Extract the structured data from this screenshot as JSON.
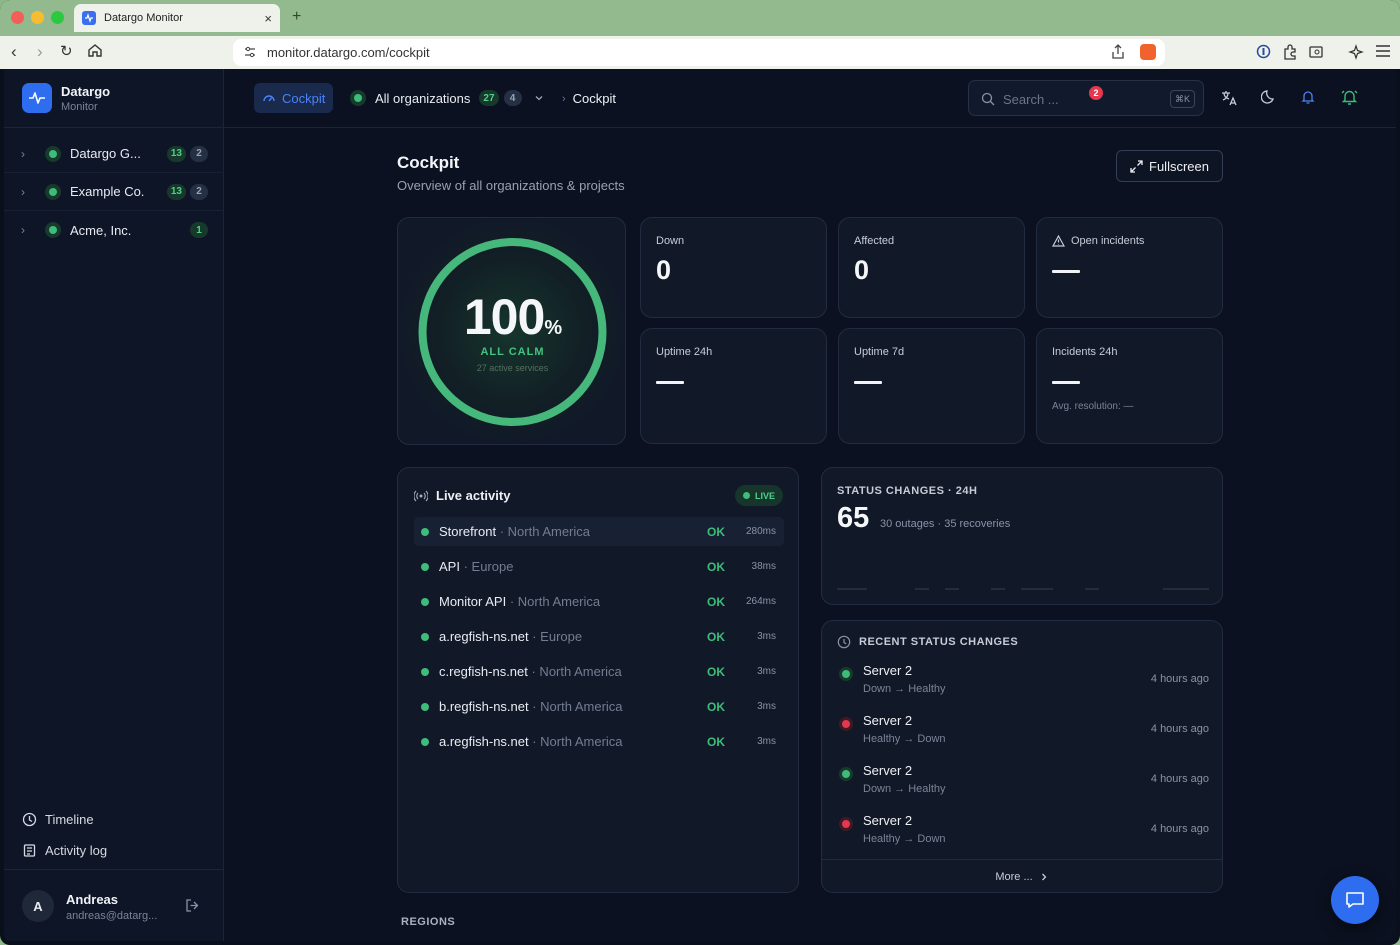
{
  "browser": {
    "tab_title": "Datargo Monitor",
    "url": "monitor.datargo.com/cockpit"
  },
  "brand": {
    "name": "Datargo",
    "sub": "Monitor"
  },
  "sidebar": {
    "orgs": [
      {
        "name": "Datargo G...",
        "count_ok": "13",
        "count_other": "2"
      },
      {
        "name": "Example Co.",
        "count_ok": "13",
        "count_other": "2"
      },
      {
        "name": "Acme, Inc.",
        "count_ok": "1"
      }
    ],
    "links": {
      "timeline": "Timeline",
      "activity_log": "Activity log"
    },
    "user": {
      "initial": "A",
      "name": "Andreas",
      "email": "andreas@datarg..."
    }
  },
  "header": {
    "cockpit_tab": "Cockpit",
    "org_selector": {
      "label": "All organizations",
      "count_ok": "27",
      "count_other": "4"
    },
    "breadcrumb": "Cockpit",
    "search": {
      "placeholder": "Search ...",
      "shortcut": "⌘K"
    },
    "notification_count": "2"
  },
  "page": {
    "title": "Cockpit",
    "subtitle": "Overview of all organizations & projects",
    "fullscreen_label": "Fullscreen"
  },
  "gauge": {
    "percent": "100",
    "unit": "%",
    "label": "ALL CALM",
    "sub": "27 active services",
    "fraction": 1.0
  },
  "stats": {
    "down": {
      "label": "Down",
      "value": "0"
    },
    "affected": {
      "label": "Affected",
      "value": "0"
    },
    "open_incidents": {
      "label": "Open incidents",
      "value": "—"
    },
    "uptime_24h": {
      "label": "Uptime 24h",
      "value": "—"
    },
    "uptime_7d": {
      "label": "Uptime 7d",
      "value": "—"
    },
    "incidents_24h": {
      "label": "Incidents 24h",
      "value": "—",
      "note": "Avg. resolution: —"
    }
  },
  "live_activity": {
    "title": "Live activity",
    "badge": "LIVE",
    "rows": [
      {
        "service": "Storefront",
        "region": " · North America",
        "status": "OK",
        "latency": "280ms"
      },
      {
        "service": "API",
        "region": " · Europe",
        "status": "OK",
        "latency": "38ms"
      },
      {
        "service": "Monitor API",
        "region": " · North America",
        "status": "OK",
        "latency": "264ms"
      },
      {
        "service": "a.regfish-ns.net",
        "region": " · Europe",
        "status": "OK",
        "latency": "3ms"
      },
      {
        "service": "c.regfish-ns.net",
        "region": " · North America",
        "status": "OK",
        "latency": "3ms"
      },
      {
        "service": "b.regfish-ns.net",
        "region": " · North America",
        "status": "OK",
        "latency": "3ms"
      },
      {
        "service": "a.regfish-ns.net",
        "region": " · North America",
        "status": "OK",
        "latency": "3ms"
      }
    ]
  },
  "status_changes": {
    "title": "STATUS CHANGES · 24H",
    "total": "65",
    "detail": "30 outages · 35 recoveries"
  },
  "recent_changes": {
    "title": "RECENT STATUS CHANGES",
    "items": [
      {
        "name": "Server 2",
        "transition": "Down → Healthy",
        "time": "4 hours ago",
        "state": "healthy"
      },
      {
        "name": "Server 2",
        "transition": "Healthy → Down",
        "time": "4 hours ago",
        "state": "down"
      },
      {
        "name": "Server 2",
        "transition": "Down → Healthy",
        "time": "4 hours ago",
        "state": "healthy"
      },
      {
        "name": "Server 2",
        "transition": "Healthy → Down",
        "time": "4 hours ago",
        "state": "down"
      }
    ],
    "more_label": "More ..."
  },
  "regions_title": "REGIONS",
  "colors": {
    "healthy": "#3dbc7a",
    "down": "#e5384f",
    "accent": "#2f6df0"
  }
}
